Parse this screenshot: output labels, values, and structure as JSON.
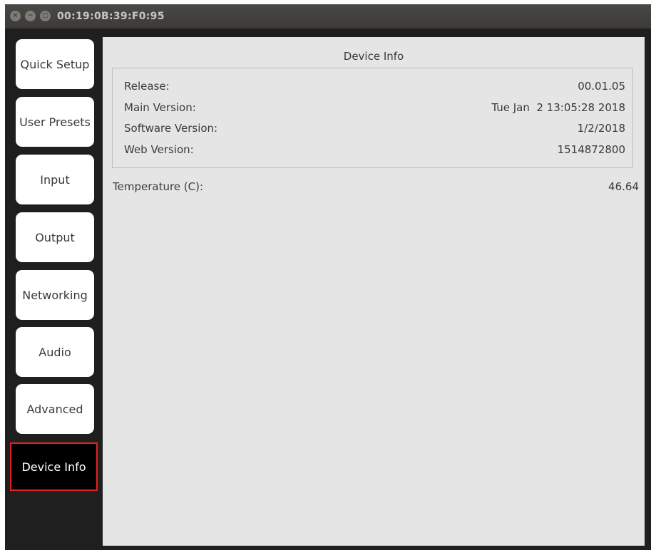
{
  "window": {
    "title": "00:19:0B:39:F0:95",
    "close_icon": "×",
    "minimize_icon": "−",
    "maximize_icon": "□"
  },
  "sidebar": {
    "items": [
      {
        "label": "Quick Setup",
        "active": false
      },
      {
        "label": "User Presets",
        "active": false
      },
      {
        "label": "Input",
        "active": false
      },
      {
        "label": "Output",
        "active": false
      },
      {
        "label": "Networking",
        "active": false
      },
      {
        "label": "Audio",
        "active": false
      },
      {
        "label": "Advanced",
        "active": false
      },
      {
        "label": "Device Info",
        "active": true
      }
    ],
    "active_outline_color": "#e02020"
  },
  "panel": {
    "title": "Device Info",
    "info": [
      {
        "label": "Release:",
        "value": "00.01.05"
      },
      {
        "label": "Main Version:",
        "value": "Tue Jan  2 13:05:28 2018"
      },
      {
        "label": "Software Version:",
        "value": "1/2/2018"
      },
      {
        "label": "Web Version:",
        "value": "1514872800"
      }
    ],
    "temperature": {
      "label": "Temperature (C):",
      "value": "46.64"
    }
  }
}
